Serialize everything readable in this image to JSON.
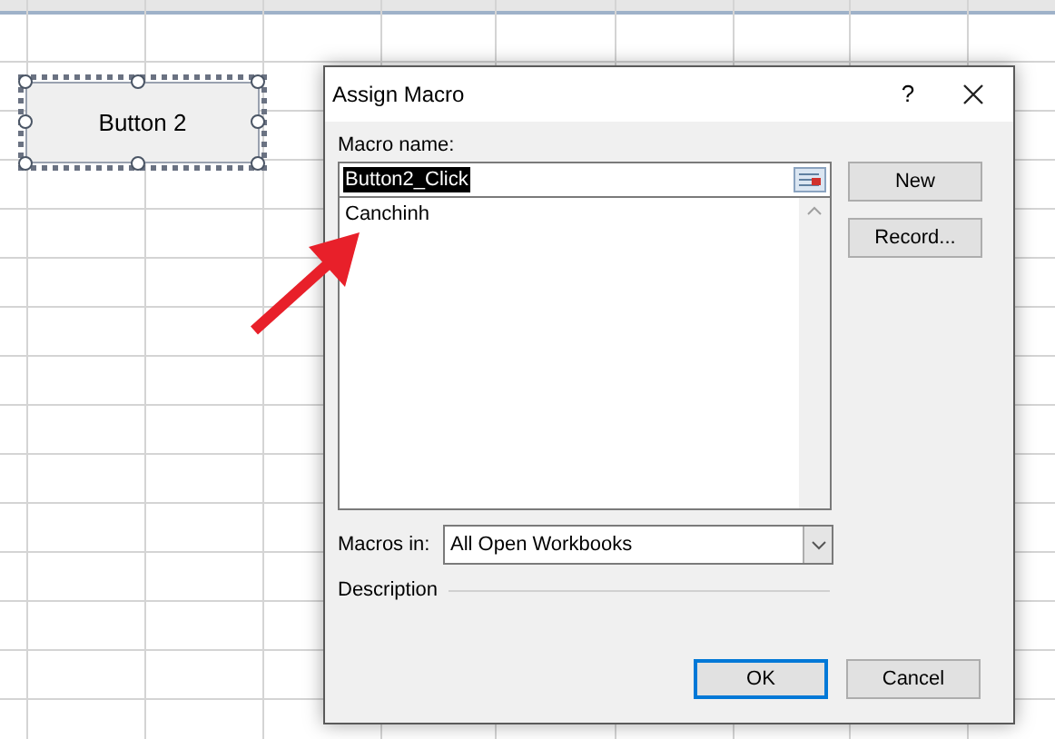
{
  "sheet": {
    "button_label": "Button 2",
    "button_selected": true
  },
  "dialog": {
    "title": "Assign Macro",
    "help": "?",
    "macro_name_label": "Macro name:",
    "macro_name_value": "Button2_Click",
    "macros": [
      {
        "name": "Canchinh",
        "selected": false
      }
    ],
    "side_buttons": [
      "New",
      "Record..."
    ],
    "macros_in_label": "Macros in:",
    "macros_in_value": "All Open Workbooks",
    "description_label": "Description",
    "bottom_buttons": [
      {
        "label": "OK",
        "default": true
      },
      {
        "label": "Cancel",
        "default": false
      }
    ]
  }
}
